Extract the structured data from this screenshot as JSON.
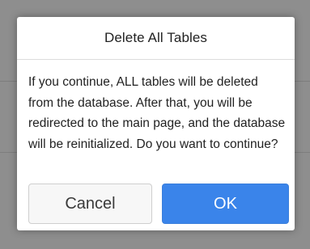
{
  "dialog": {
    "title": "Delete All Tables",
    "message": "If you continue, ALL tables will be deleted from the database. After that, you will be redirected to the main page, and the database will be reinitialized. Do you want to continue?",
    "cancel_label": "Cancel",
    "ok_label": "OK"
  },
  "colors": {
    "overlay": "#8e8e8e",
    "dialog_background": "#ffffff",
    "ok_button": "#3a84ea",
    "cancel_button": "#f7f7f7"
  }
}
